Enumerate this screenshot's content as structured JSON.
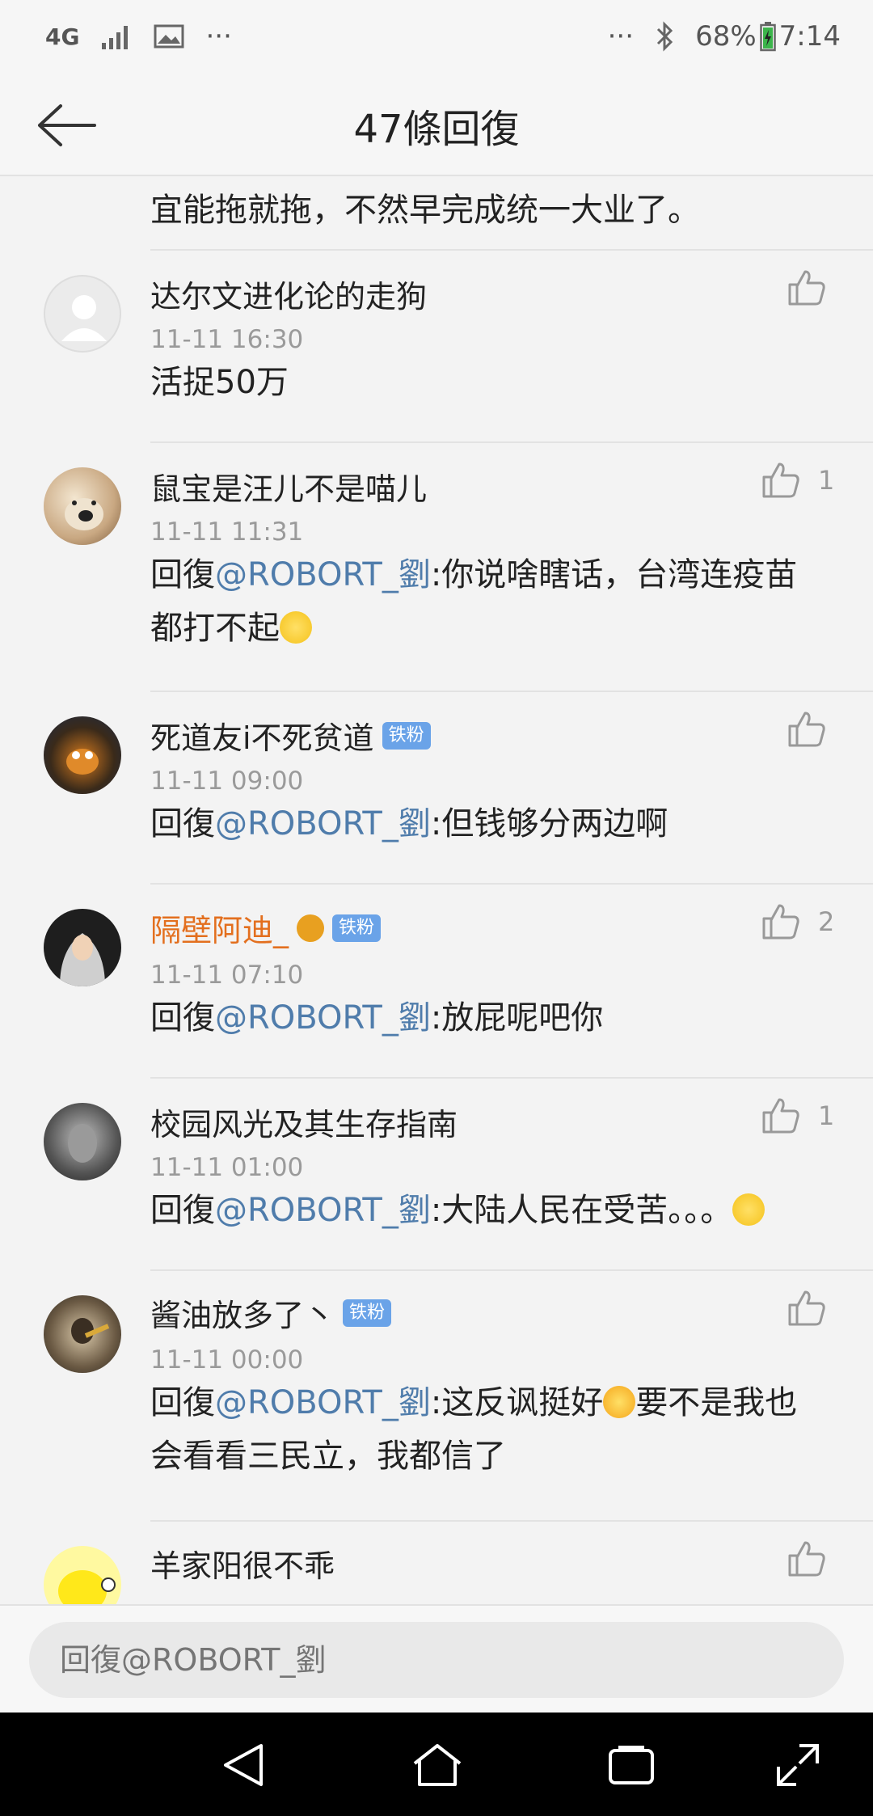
{
  "status": {
    "network": "4G",
    "more": "···",
    "more_right": "···",
    "battery": "68%",
    "time": "7:14"
  },
  "header": {
    "title": "47條回復"
  },
  "partial_comment_text": "宜能拖就拖，不然早完成统一大业了。",
  "comments": [
    {
      "user": "达尔文进化论的走狗",
      "time": "11-11 16:30",
      "text": "活捉50万",
      "likes": ""
    },
    {
      "user": "鼠宝是汪儿不是喵儿",
      "time": "11-11 11:31",
      "prefix": "回復",
      "mention": "@ROBORT_劉",
      "text": ":你说啥瞎话，台湾连疫苗都打不起",
      "likes": "1"
    },
    {
      "user": "死道友i不死贫道",
      "badge": "铁粉",
      "time": "11-11 09:00",
      "prefix": "回復",
      "mention": "@ROBORT_劉",
      "text": ":但钱够分两边啊",
      "likes": ""
    },
    {
      "user": "隔壁阿迪_",
      "badge": "铁粉",
      "time": "11-11 07:10",
      "prefix": "回復",
      "mention": "@ROBORT_劉",
      "text": ":放屁呢吧你",
      "likes": "2"
    },
    {
      "user": "校园风光及其生存指南",
      "time": "11-11 01:00",
      "prefix": "回復",
      "mention": "@ROBORT_劉",
      "text": ":大陆人民在受苦。。。",
      "likes": "1"
    },
    {
      "user": "酱油放多了丶",
      "badge": "铁粉",
      "time": "11-11 00:00",
      "prefix": "回復",
      "mention": "@ROBORT_劉",
      "text": ":这反讽挺好",
      "text2": "要不是我也会看看三民立，我都信了",
      "likes": ""
    },
    {
      "user": "羊家阳很不乖"
    }
  ],
  "reply": {
    "placeholder": "回復@ROBORT_劉"
  },
  "colors": {
    "mention": "#4f7cab",
    "orange_name": "#e36f1e",
    "badge": "#6aa3e8"
  },
  "icons": [
    "back-arrow-icon",
    "thumbs-up-icon",
    "bluetooth-icon",
    "signal-icon",
    "image-icon",
    "battery-icon"
  ]
}
